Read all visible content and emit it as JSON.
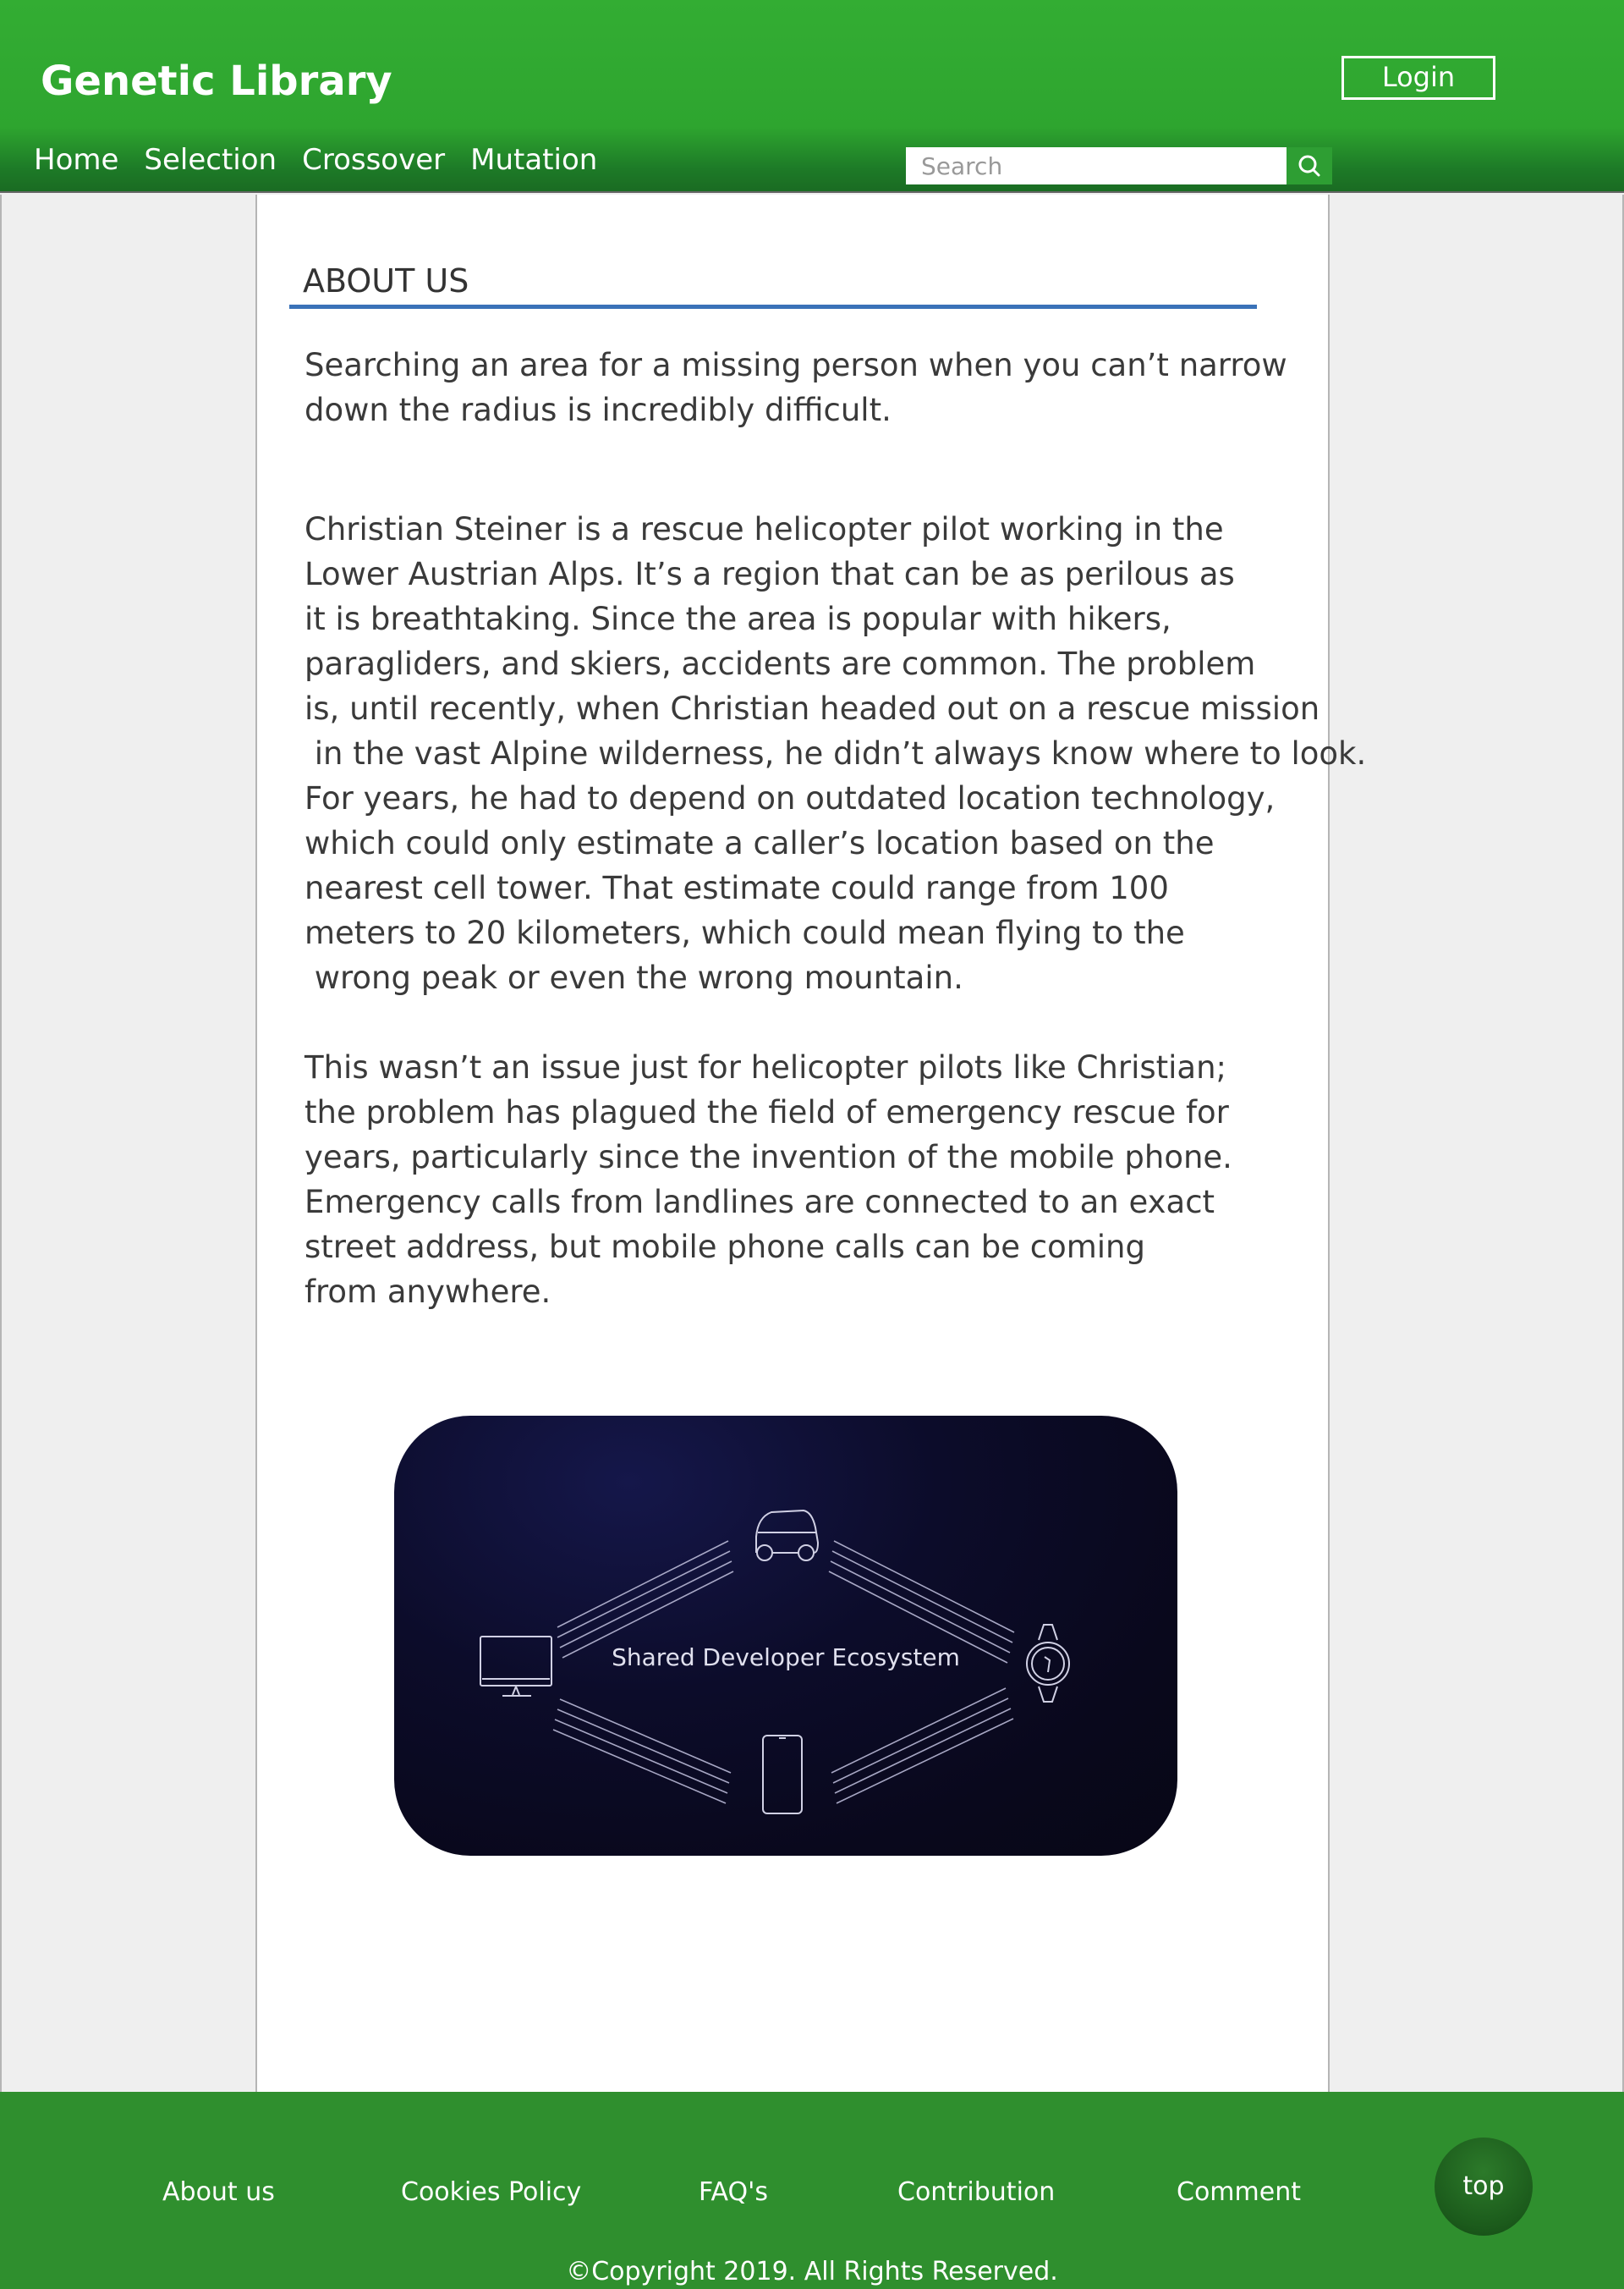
{
  "header": {
    "brand": "Genetic Library",
    "login_label": "Login",
    "nav": [
      "Home",
      "Selection",
      "Crossover",
      "Mutation"
    ],
    "search_placeholder": "Search",
    "colors": {
      "header_green": "#33ad33",
      "accent_blue": "#3a72b8",
      "footer_green": "#2f8f2e"
    }
  },
  "main": {
    "section_title": "ABOUT US",
    "paragraphs": [
      "Searching an area for a missing person when you can’t narrow\ndown the radius is incredibly difficult.",
      "Christian Steiner is a rescue helicopter pilot working in the\nLower Austrian Alps. It’s a region that can be as perilous as\nit is breathtaking. Since the area is popular with hikers,\nparagliders, and skiers, accidents are common. The problem\nis, until recently, when Christian headed out on a rescue mission\n in the vast Alpine wilderness, he didn’t always know where to look.",
      "For years, he had to depend on outdated location technology,\nwhich could only estimate a caller’s location based on the\nnearest cell tower. That estimate could range from 100\nmeters to 20 kilometers, which could mean flying to the\n wrong peak or even the wrong mountain.",
      "This wasn’t an issue just for helicopter pilots like Christian;\nthe problem has plagued the field of emergency rescue for\nyears, particularly since the invention of the mobile phone.\nEmergency calls from landlines are connected to an exact\nstreet address, but mobile phone calls can be coming\nfrom anywhere."
    ],
    "image": {
      "caption": "Shared Developer Ecosystem",
      "icons": [
        "car-icon",
        "monitor-icon",
        "watch-icon",
        "phone-icon"
      ]
    }
  },
  "footer": {
    "links": [
      "About us",
      "Cookies Policy",
      "FAQ's",
      "Contribution",
      "Comment"
    ],
    "top_label": "top",
    "copyright": "©Copyright 2019. All Rights Reserved."
  }
}
